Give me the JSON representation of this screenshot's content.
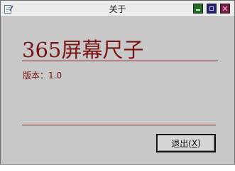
{
  "window": {
    "title": "关于",
    "icon": "notepad-icon",
    "controls": {
      "minimize_icon": "minimize-icon",
      "maximize_icon": "maximize-icon",
      "close_icon": "close-icon"
    }
  },
  "content": {
    "app_name": "365屏幕尺子",
    "version_label": "版本：",
    "version_value": "1.0"
  },
  "buttons": {
    "exit_label": "退出(",
    "exit_mnemonic": "X",
    "exit_suffix": ")"
  },
  "colors": {
    "accent": "#7a1414",
    "background": "#c8c8c8",
    "minimize": "#1f6e1f",
    "maximize": "#22227a",
    "close": "#7a1a3a"
  }
}
